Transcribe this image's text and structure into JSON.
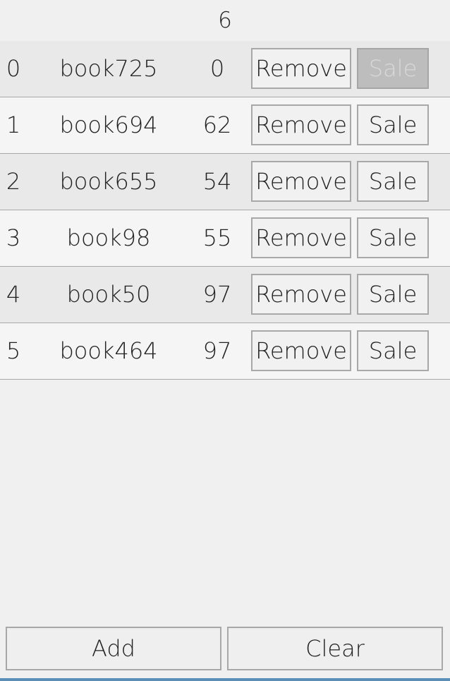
{
  "header": {
    "count": "6"
  },
  "rows": [
    {
      "index": "0",
      "name": "book725",
      "qty": "0",
      "remove_label": "Remove",
      "sale_label": "Sale",
      "sale_disabled": true
    },
    {
      "index": "1",
      "name": "book694",
      "qty": "62",
      "remove_label": "Remove",
      "sale_label": "Sale",
      "sale_disabled": false
    },
    {
      "index": "2",
      "name": "book655",
      "qty": "54",
      "remove_label": "Remove",
      "sale_label": "Sale",
      "sale_disabled": false
    },
    {
      "index": "3",
      "name": "book98",
      "qty": "55",
      "remove_label": "Remove",
      "sale_label": "Sale",
      "sale_disabled": false
    },
    {
      "index": "4",
      "name": "book50",
      "qty": "97",
      "remove_label": "Remove",
      "sale_label": "Sale",
      "sale_disabled": false
    },
    {
      "index": "5",
      "name": "book464",
      "qty": "97",
      "remove_label": "Remove",
      "sale_label": "Sale",
      "sale_disabled": false
    }
  ],
  "footer": {
    "add_label": "Add",
    "clear_label": "Clear"
  }
}
